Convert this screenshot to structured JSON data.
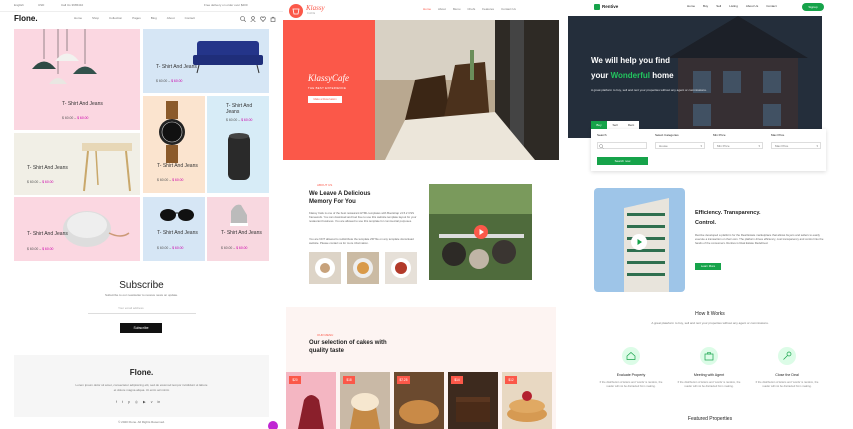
{
  "flone": {
    "topbar": {
      "lang": "English",
      "currency": "USD",
      "phone": "Call Us 3965410",
      "promo": "Free delivery on order over $200"
    },
    "logo": "Flone.",
    "nav": [
      "Home",
      "Shop",
      "Collection",
      "Pages",
      "Blog",
      "About",
      "Contact"
    ],
    "products": [
      {
        "title": "T- Shirt And Jeans",
        "old_price": "$ 60.00",
        "price": "$ 60.00"
      },
      {
        "title": "T- Shirt And Jeans",
        "old_price": "$ 60.00",
        "price": "$ 60.00"
      },
      {
        "title": "T- Shirt And Jeans",
        "old_price": "$ 60.00",
        "price": "$ 60.00"
      },
      {
        "title": "T- Shirt And Jeans",
        "old_price": "$ 60.00",
        "price": "$ 60.00"
      },
      {
        "title": "T- Shirt And Jeans",
        "old_price": "$ 60.00",
        "price": "$ 60.00"
      },
      {
        "title": "T- Shirt And Jeans",
        "old_price": "$ 60.00",
        "price": "$ 60.00"
      },
      {
        "title": "T- Shirt And Jeans",
        "old_price": "$ 60.00",
        "price": "$ 60.00"
      },
      {
        "title": "T- Shirt And Jeans",
        "old_price": "$ 60.00",
        "price": "$ 60.00"
      },
      {
        "title": "T- Shirt And Jeans",
        "old_price": "$ 60.00",
        "price": "$ 60.00"
      }
    ],
    "subscribe": {
      "title": "Subscribe",
      "subtitle": "Subscribe to our newsletter to receive news on update.",
      "placeholder": "Your email address",
      "button": "Subscribe"
    },
    "footer": {
      "logo": "Flone.",
      "text": "Lorem ipsum dolor sit amet, consectetur adipisicing elit, sed do eiusmod tempor incididunt ut labore et dolore magna aliqua. Ut enim ad minim",
      "copyright": "© 2020 Flone. All Rights Reserved."
    }
  },
  "klassy": {
    "logo": "Klassy",
    "logo_sub": "CAFE",
    "nav": [
      "Home",
      "About",
      "Menu",
      "Chefs",
      "Features",
      "Contact Us"
    ],
    "hero": {
      "title": "KlassyCafe",
      "subtitle": "THE BEST EXPERIENCE",
      "button": "Make a Reservation"
    },
    "about": {
      "tag": "ABOUT US",
      "title": "We Leave A Delicious Memory For You",
      "text1": "Klassy Cafe is one of the best restaurant HTML templates with Bootstrap v4.5.2 CSS framework. You can download and feel free to use this website template layout for your restaurant business. You are allowed to use this template for commercial purposes.",
      "text2": "You are NOT allowed to redistribute the template ZIP file on any template donwnload website. Please contact us for more information."
    },
    "menu": {
      "tag": "OUR MENU",
      "title": "Our selection of cakes with quality taste"
    },
    "prices": [
      "$20",
      "$18",
      "$7.25",
      "$14",
      "$12"
    ]
  },
  "rentive": {
    "logo": "Rentive",
    "nav": [
      "Home",
      "Buy",
      "Sell",
      "Listing",
      "About Us",
      "Contact"
    ],
    "signup": "Signup",
    "hero": {
      "line1": "We will help you find",
      "line2a": "your ",
      "line2b": "Wonderful",
      "line2c": " home",
      "text": "A great platform to buy, sell and rent your properties without any agent or commissions."
    },
    "search": {
      "tabs": [
        "Buy",
        "Sell",
        "Rent"
      ],
      "fields": [
        {
          "label": "Search",
          "value": ""
        },
        {
          "label": "Select Categories",
          "value": "House"
        },
        {
          "label": "Min Price",
          "value": "Min Price"
        },
        {
          "label": "Max Price",
          "value": "Max Price"
        }
      ],
      "button": "Search now"
    },
    "feature": {
      "title1": "Efficiency. Transparency.",
      "title2": "Control.",
      "text": "Rentive developed a platform for the Real Estate marketplace that allows buyers and sellers to easily execute a transaction on their own. The platform drives efficiency, cost transparency and control into the hands of the consumers. Rentive is Real Estate Redefined.",
      "button": "Learn More"
    },
    "how": {
      "title": "How It Works",
      "subtitle": "A great plateform to buy, sell and rent your properties without any agent or commissions.",
      "steps": [
        {
          "title": "Evaluate Property",
          "text": "If the distribution of letters and 'words' is random, the reader will not be distracted from making."
        },
        {
          "title": "Meeting with Agent",
          "text": "If the distribution of letters and 'words' is random, the reader will not be distracted from making."
        },
        {
          "title": "Close the Deal",
          "text": "If the distribution of letters and 'words' is random, the reader will not be distracted from making."
        }
      ]
    },
    "featured_title": "Featured Properties"
  },
  "colors": {
    "flone_accent": "#c026d3",
    "klassy_accent": "#fb5849",
    "rentive_accent": "#16a34a"
  }
}
